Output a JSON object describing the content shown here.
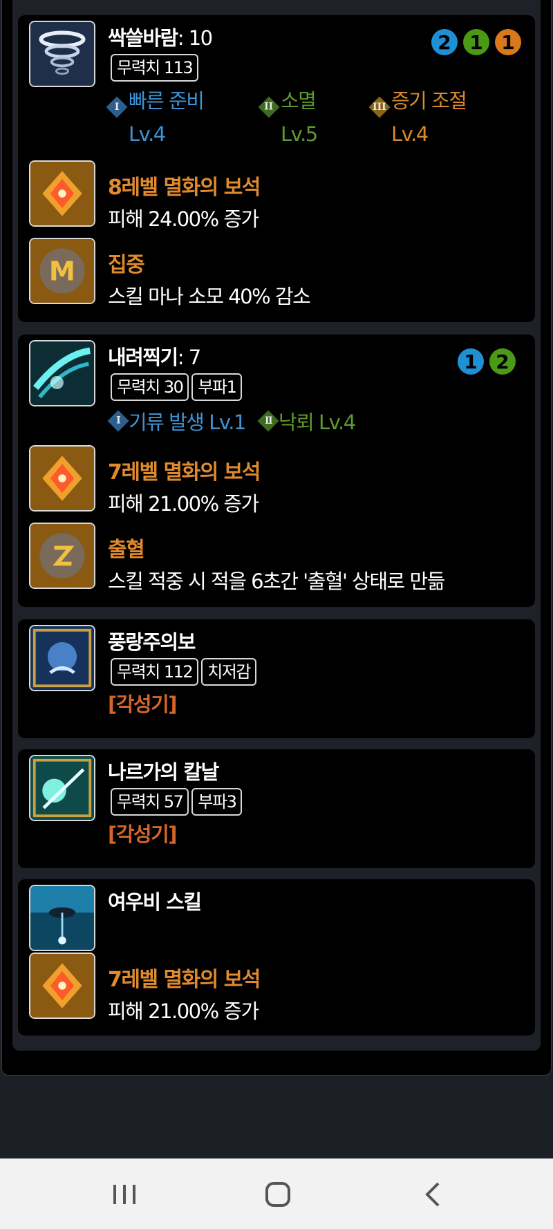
{
  "skills": [
    {
      "name": "싹쓸바람",
      "level": ": 10",
      "tags": [
        "무력치 113"
      ],
      "dots": [
        {
          "num": "2",
          "color": "#1f8fd6"
        },
        {
          "num": "1",
          "color": "#4b9a16"
        },
        {
          "num": "1",
          "color": "#d9791c"
        }
      ],
      "tripods": [
        {
          "numeral": "I",
          "name": "빠른 준비",
          "level": "Lv.4",
          "color": "#3c94d6"
        },
        {
          "numeral": "II",
          "name": "소멸",
          "level": "Lv.5",
          "color": "#5e9a2c"
        },
        {
          "numeral": "III",
          "name": "증기 조절",
          "level": "Lv.4",
          "color": "#d98a2a"
        }
      ],
      "gem": {
        "name": "8레벨 멸화의 보석",
        "desc": "피해 24.00% 증가"
      },
      "rune": {
        "name": "집중",
        "desc": "스킬 마나 소모 40% 감소"
      }
    },
    {
      "name": "내려찍기",
      "level": ": 7",
      "tags": [
        "무력치 30",
        "부파1"
      ],
      "dots": [
        {
          "num": "1",
          "color": "#1f8fd6"
        },
        {
          "num": "2",
          "color": "#4b9a16"
        }
      ],
      "tripods": [
        {
          "numeral": "I",
          "text": "기류 발생 Lv.1",
          "color": "#3c94d6"
        },
        {
          "numeral": "II",
          "text": "낙뢰 Lv.4",
          "color": "#5e9a2c"
        }
      ],
      "gem": {
        "name": "7레벨 멸화의 보석",
        "desc": "피해 21.00% 증가"
      },
      "rune": {
        "name": "출혈",
        "desc": "스킬 적중 시 적을 6초간 '출혈' 상태로 만듦"
      }
    },
    {
      "name": "풍랑주의보",
      "tags": [
        "무력치 112",
        "치저감"
      ],
      "awakening": "[각성기]"
    },
    {
      "name": "나르가의 칼날",
      "tags": [
        "무력치 57",
        "부파3"
      ],
      "awakening": "[각성기]"
    },
    {
      "name": "여우비 스킬",
      "gem": {
        "name": "7레벨 멸화의 보석",
        "desc": "피해 21.00% 증가"
      }
    }
  ],
  "colors": {
    "gem_name": "#e08a2c",
    "awakening": "#d4652a",
    "tripod_1": "#3c94d6",
    "tripod_2": "#5e9a2c",
    "tripod_3": "#d98a2a"
  },
  "icons": {
    "skill_1": "tornado-skill-icon",
    "skill_2": "slash-skill-icon",
    "skill_3": "storm-warning-skill-icon",
    "skill_4": "narga-blade-skill-icon",
    "skill_5": "fox-rain-skill-icon",
    "gem": "gem-icon",
    "rune": "rune-icon"
  },
  "nav": {
    "recents": "recents-icon",
    "home": "home-icon",
    "back": "back-icon"
  }
}
